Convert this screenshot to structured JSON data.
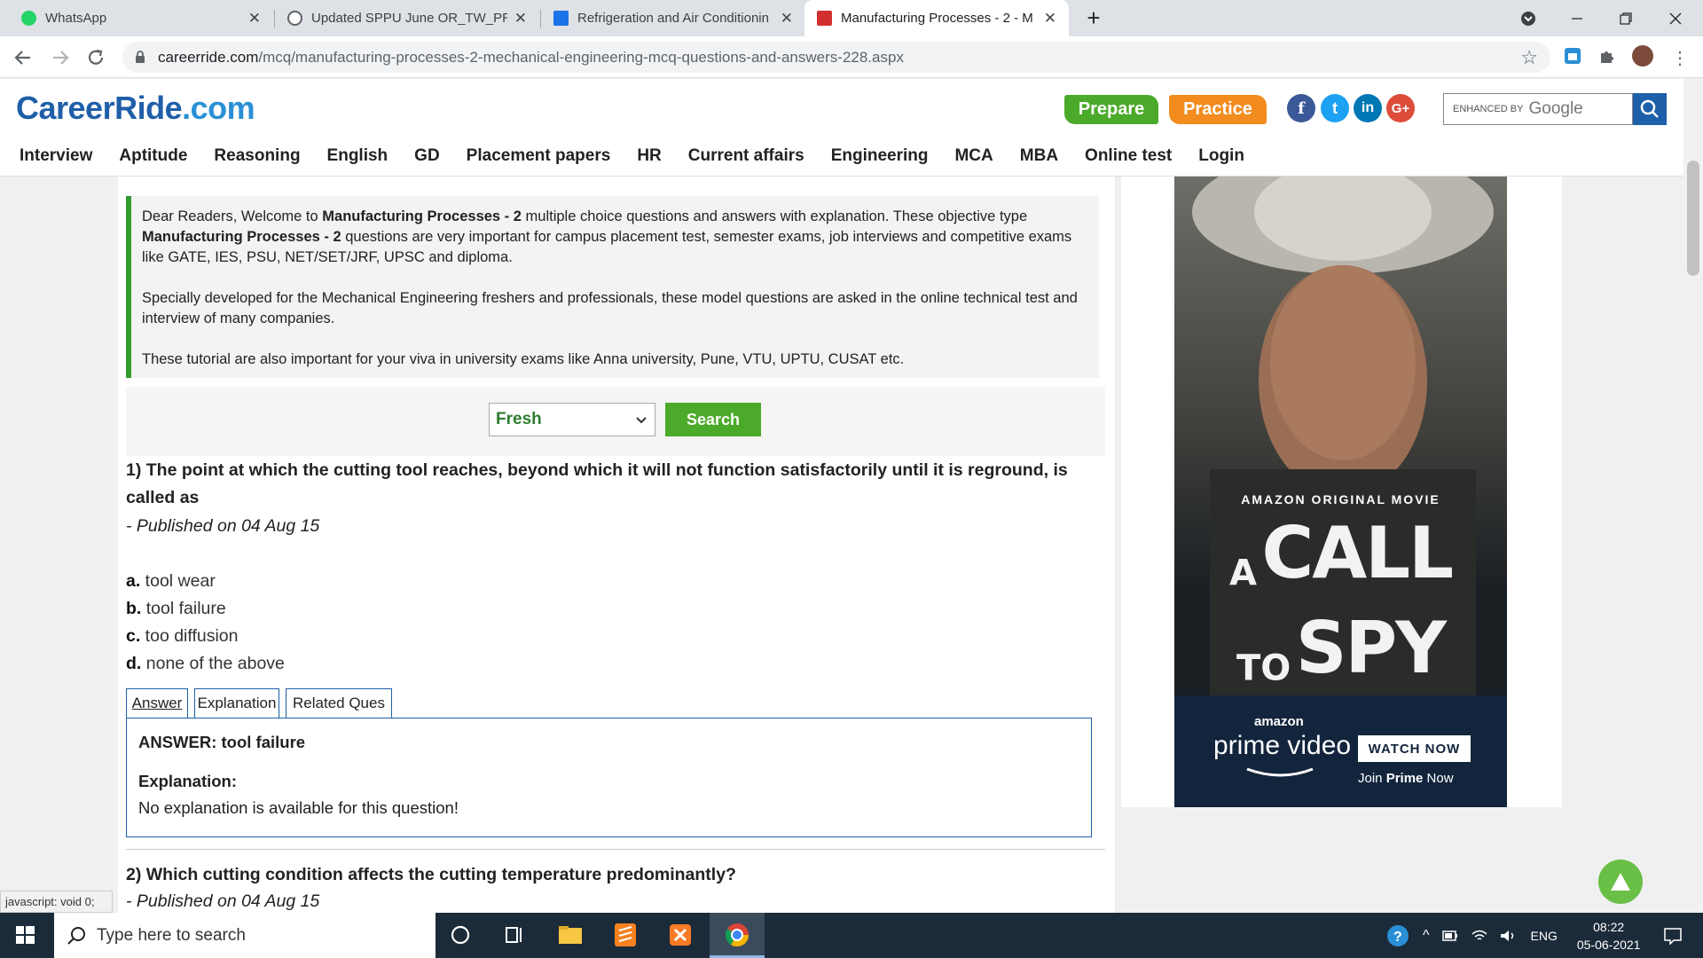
{
  "browser": {
    "tabs": [
      {
        "title": "WhatsApp"
      },
      {
        "title": "Updated SPPU June OR_TW_PR e"
      },
      {
        "title": "Refrigeration and Air Conditionin"
      },
      {
        "title": "Manufacturing Processes - 2 - M"
      }
    ],
    "url_domain": "careerride.com",
    "url_path": "/mcq/manufacturing-processes-2-mechanical-engineering-mcq-questions-and-answers-228.aspx",
    "new_tab": "+",
    "close": "✕"
  },
  "site": {
    "logo_main": "CareerRide",
    "logo_tld": ".com",
    "prepare": "Prepare",
    "practice": "Practice",
    "search_enhanced": "ENHANCED BY",
    "search_google": "Google",
    "social": {
      "facebook": "f",
      "twitter": "t",
      "linkedin": "in",
      "google": "G+"
    },
    "menu": [
      "Interview",
      "Aptitude",
      "Reasoning",
      "English",
      "GD",
      "Placement papers",
      "HR",
      "Current affairs",
      "Engineering",
      "MCA",
      "MBA",
      "Online test",
      "Login"
    ]
  },
  "intro": {
    "p1_a": "Dear Readers, Welcome to ",
    "p1_b": "Manufacturing Processes - 2",
    "p1_c": " multiple choice questions and answers with explanation. These objective type ",
    "p1_d": "Manufacturing Processes - 2",
    "p1_e": " questions are very important for campus placement test, semester exams, job interviews and competitive exams like GATE, IES, PSU, NET/SET/JRF, UPSC and diploma.",
    "p2": "Specially developed for the Mechanical Engineering freshers and professionals, these model questions are asked in the online technical test and interview of many companies.",
    "p3": "These tutorial are also important for your viva in university exams like Anna university, Pune, VTU, UPTU, CUSAT etc."
  },
  "filter": {
    "selected": "Fresh",
    "search_label": "Search"
  },
  "q1": {
    "text": "1)   The point at which the cutting tool reaches, beyond which it will not function satisfactorily until it is reground, is called as",
    "published": "- Published on 04 Aug 15",
    "options": [
      {
        "key": "a.",
        "text": " tool wear"
      },
      {
        "key": "b.",
        "text": " tool failure"
      },
      {
        "key": "c.",
        "text": " too diffusion"
      },
      {
        "key": "d.",
        "text": " none of the above"
      }
    ],
    "tabs": [
      "Answer",
      "Explanation",
      "Related Ques"
    ],
    "answer": "ANSWER: tool failure",
    "explanation_label": "Explanation:",
    "explanation": "No explanation is available for this question!"
  },
  "q2": {
    "text": "2)   Which cutting condition affects the cutting temperature predominantly?",
    "published": "- Published on 04 Aug 15"
  },
  "ad": {
    "tagline": "AMAZON ORIGINAL MOVIE",
    "title_a": "A",
    "title_b": "CALL",
    "title_c": "TO",
    "title_d": "SPY",
    "brand_small": "amazon",
    "brand": "prime video",
    "watch": "WATCH NOW",
    "join_a": "Join ",
    "join_b": "Prime",
    "join_c": " Now"
  },
  "status_text": "javascript: void 0;",
  "taskbar": {
    "search_placeholder": "Type here to search",
    "lang": "ENG",
    "time": "08:22",
    "date": "05-06-2021"
  },
  "colors": {
    "brand_blue": "#1f5fa8",
    "green": "#4caa2a",
    "orange": "#f28c1e",
    "intro_border": "#2d9b2d"
  }
}
